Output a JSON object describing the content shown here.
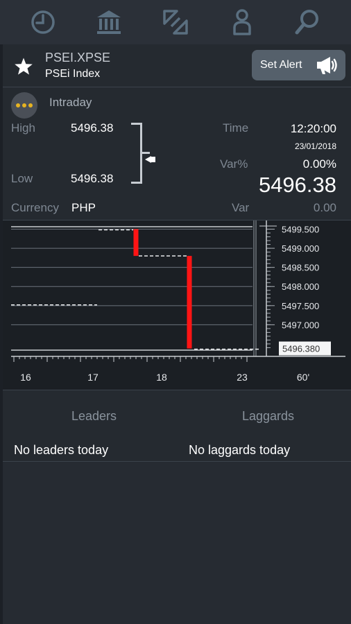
{
  "nav": {
    "items": [
      {
        "name": "clock-icon"
      },
      {
        "name": "bank-icon"
      },
      {
        "name": "exchange-icon"
      },
      {
        "name": "user-icon"
      },
      {
        "name": "search-icon"
      }
    ]
  },
  "instrument": {
    "symbol": "PSEI.XPSE",
    "name": "PSEi Index",
    "alert_label": "Set Alert"
  },
  "quote": {
    "period": "Intraday",
    "high_label": "High",
    "high": "5496.38",
    "low_label": "Low",
    "low": "5496.38",
    "time_label": "Time",
    "time": "12:20:00",
    "date": "23/01/2018",
    "varpct_label": "Var%",
    "varpct": "0.00%",
    "last": "5496.38",
    "currency_label": "Currency",
    "currency": "PHP",
    "var_label": "Var",
    "var": "0.00"
  },
  "chart_data": {
    "type": "line",
    "y_tick_labels": [
      "5499.500",
      "5499.000",
      "5498.500",
      "5498.000",
      "5497.500",
      "5497.000"
    ],
    "ylim": [
      5496.3,
      5499.6
    ],
    "current_value": "5496.380",
    "x_tick_labels": [
      "16",
      "17",
      "18",
      "23",
      "60'"
    ],
    "down_moves": [
      {
        "from": 5499.5,
        "to": 5498.8
      },
      {
        "from": 5498.8,
        "to": 5496.38
      }
    ],
    "colors": {
      "down": "#ff1414",
      "grid": "#6c737c"
    }
  },
  "movers": {
    "leaders_label": "Leaders",
    "laggards_label": "Laggards",
    "leaders_empty": "No leaders today",
    "laggards_empty": "No laggards today"
  }
}
